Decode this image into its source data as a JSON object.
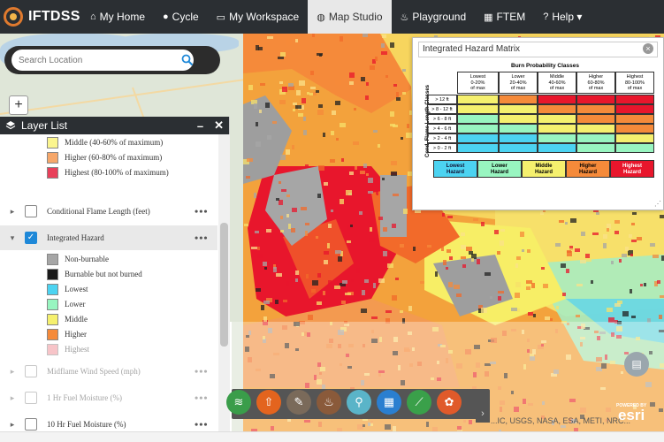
{
  "app": {
    "logo_text": "IFTDSS",
    "nav": [
      {
        "label": "My Home",
        "icon": "home-icon",
        "glyph": "⌂"
      },
      {
        "label": "Cycle",
        "icon": "cycle-icon",
        "glyph": "●"
      },
      {
        "label": "My Workspace",
        "icon": "folder-icon",
        "glyph": "▭"
      },
      {
        "label": "Map Studio",
        "icon": "globe-icon",
        "glyph": "◍",
        "active": true
      },
      {
        "label": "Playground",
        "icon": "flame-icon",
        "glyph": "♨"
      },
      {
        "label": "FTEM",
        "icon": "table-icon",
        "glyph": "▦"
      },
      {
        "label": "Help ▾",
        "icon": "question-icon",
        "glyph": "?"
      }
    ]
  },
  "search": {
    "placeholder": "Search Location"
  },
  "zoom": {
    "plus": "+"
  },
  "layer_list": {
    "title": "Layer List",
    "minimize": "–",
    "close": "✕",
    "top_legend": [
      {
        "label": "Middle (40-60% of maximum)",
        "color": "#fbf58f"
      },
      {
        "label": "Higher (60-80% of maximum)",
        "color": "#f6a76a"
      },
      {
        "label": "Highest (80-100% of maximum)",
        "color": "#e8405a"
      }
    ],
    "layers": {
      "conditional": "Conditional Flame Length (feet)",
      "integrated": "Integrated Hazard",
      "midflame": "Midflame Wind Speed (mph)",
      "fuel1": "1 Hr Fuel Moisture (%)",
      "fuel10": "10 Hr Fuel Moisture (%)"
    },
    "hazard_legend": [
      {
        "label": "Non-burnable",
        "color": "#a6a6a6"
      },
      {
        "label": "Burnable but not burned",
        "color": "#1a1a1a"
      },
      {
        "label": "Lowest",
        "color": "#4cd3f1"
      },
      {
        "label": "Lower",
        "color": "#98f5c0"
      },
      {
        "label": "Middle",
        "color": "#f5f06e"
      },
      {
        "label": "Higher",
        "color": "#f58a3a"
      },
      {
        "label": "Highest",
        "color": "#f08a93"
      }
    ],
    "more": "•••"
  },
  "matrix": {
    "title": "Integrated Hazard Matrix",
    "close": "×",
    "col_title": "Burn Probability Classes",
    "row_title": "Cond. Flame Length Classes",
    "columns": [
      {
        "name": "Lowest",
        "range": "0-20%",
        "sub": "of max"
      },
      {
        "name": "Lower",
        "range": "20-40%",
        "sub": "of max"
      },
      {
        "name": "Middle",
        "range": "40-60%",
        "sub": "of max"
      },
      {
        "name": "Higher",
        "range": "60-80%",
        "sub": "of max"
      },
      {
        "name": "Highest",
        "range": "80-100%",
        "sub": "of max"
      }
    ],
    "rows": [
      "> 12 ft",
      "> 8 - 12 ft",
      "> 6 - 8 ft",
      "> 4 - 6 ft",
      "> 2 - 4 ft",
      "> 0 - 2 ft"
    ],
    "cells": [
      [
        "#f5f06e",
        "#f58a3a",
        "#e8162c",
        "#e8162c",
        "#e8162c"
      ],
      [
        "#f5f06e",
        "#f5f06e",
        "#f58a3a",
        "#f58a3a",
        "#e8162c"
      ],
      [
        "#98f5c0",
        "#f5f06e",
        "#f5f06e",
        "#f58a3a",
        "#f58a3a"
      ],
      [
        "#98f5c0",
        "#98f5c0",
        "#f5f06e",
        "#f5f06e",
        "#f58a3a"
      ],
      [
        "#4cd3f1",
        "#4cd3f1",
        "#98f5c0",
        "#98f5c0",
        "#f5f06e"
      ],
      [
        "#4cd3f1",
        "#4cd3f1",
        "#4cd3f1",
        "#98f5c0",
        "#98f5c0"
      ]
    ],
    "key": [
      {
        "line1": "Lowest",
        "line2": "Hazard",
        "color": "#4cd3f1"
      },
      {
        "line1": "Lower",
        "line2": "Hazard",
        "color": "#98f5c0"
      },
      {
        "line1": "Middle",
        "line2": "Hazard",
        "color": "#f5f06e"
      },
      {
        "line1": "Higher",
        "line2": "Hazard",
        "color": "#f58a3a"
      },
      {
        "line1": "Highest",
        "line2": "Hazard",
        "color": "#e8162c"
      }
    ]
  },
  "toolbar": {
    "tools": [
      {
        "name": "layers-tool-icon",
        "glyph": "≋",
        "color": "#3a9d4a"
      },
      {
        "name": "upload-tool-icon",
        "glyph": "⇧",
        "color": "#e3641e"
      },
      {
        "name": "edit-tool-icon",
        "glyph": "✎",
        "color": "#7a6a5a"
      },
      {
        "name": "fire-tool-icon",
        "glyph": "♨",
        "color": "#8a5a3a"
      },
      {
        "name": "marker-tool-icon",
        "glyph": "⚲",
        "color": "#5ab4c8"
      },
      {
        "name": "grid-tool-icon",
        "glyph": "▦",
        "color": "#2a7fd0"
      },
      {
        "name": "measure-tool-icon",
        "glyph": "⟋",
        "color": "#3aa04a"
      },
      {
        "name": "palette-tool-icon",
        "glyph": "✿",
        "color": "#e05a2a"
      }
    ],
    "next": "›"
  },
  "basemap_button": "▤",
  "attribution": "...IC, USGS, NASA, ESA, METI, NRC...",
  "esri": {
    "powered": "POWERED BY",
    "brand": "esri"
  }
}
